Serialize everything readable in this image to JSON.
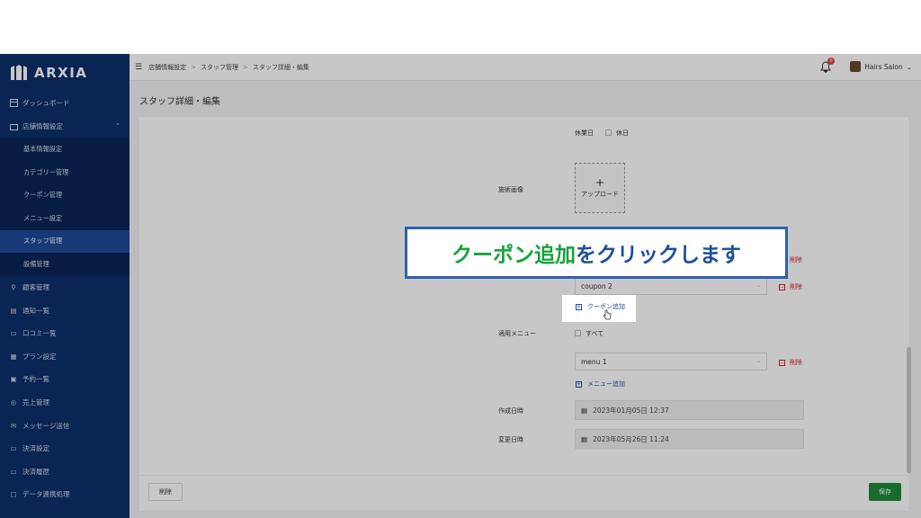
{
  "app": {
    "logo_text": "ARXIA"
  },
  "sidebar": {
    "items": [
      {
        "label": "ダッシュボード",
        "icon": "dashboard-icon"
      },
      {
        "label": "店舗情報設定",
        "icon": "store-icon",
        "expanded": true
      },
      {
        "label": "顧客管理",
        "icon": "customer-icon"
      },
      {
        "label": "通知一覧",
        "icon": "notice-icon"
      },
      {
        "label": "口コミ一覧",
        "icon": "review-icon"
      },
      {
        "label": "プラン設定",
        "icon": "plan-icon"
      },
      {
        "label": "予約一覧",
        "icon": "calendar-icon"
      },
      {
        "label": "売上管理",
        "icon": "sales-icon"
      },
      {
        "label": "メッセージ送信",
        "icon": "message-icon"
      },
      {
        "label": "決済設定",
        "icon": "payment-icon"
      },
      {
        "label": "決済履歴",
        "icon": "history-icon"
      },
      {
        "label": "データ連携処理",
        "icon": "data-icon"
      }
    ],
    "subitems": [
      {
        "label": "基本情報設定"
      },
      {
        "label": "カテゴリー管理"
      },
      {
        "label": "クーポン管理"
      },
      {
        "label": "メニュー設定"
      },
      {
        "label": "スタッフ管理",
        "active": true
      },
      {
        "label": "設備管理"
      }
    ]
  },
  "header": {
    "breadcrumb": [
      "店舗情報設定",
      "スタッフ管理",
      "スタッフ詳細・編集"
    ],
    "notification_count": "0",
    "account_name": "Hairs Salon"
  },
  "page": {
    "title": "スタッフ詳細・編集"
  },
  "form": {
    "holiday_label": "休業日",
    "holiday_option": "休日",
    "image_label": "施術画像",
    "upload_label": "アップロード",
    "coupon_selected": "coupon 2",
    "delete_label": "削除",
    "add_coupon_label": "クーポン追加",
    "menu_label": "適用メニュー",
    "menu_all_label": "すべて",
    "menu_selected": "menu 1",
    "add_menu_label": "メニュー追加",
    "created_label": "作成日時",
    "created_value": "2023年01月05日 12:37",
    "updated_label": "変更日時",
    "updated_value": "2023年05月26日 11:24"
  },
  "footer": {
    "delete_button": "削除",
    "save_button": "保存"
  },
  "callout": {
    "highlight_text": "クーポン追加",
    "rest_text": "をクリックします"
  },
  "colors": {
    "sidebar": "#0d2f6b",
    "accent": "#1d4fa3",
    "save": "#1f8a3b",
    "callout_green": "#15a33c",
    "callout_border": "#2a62b3"
  }
}
